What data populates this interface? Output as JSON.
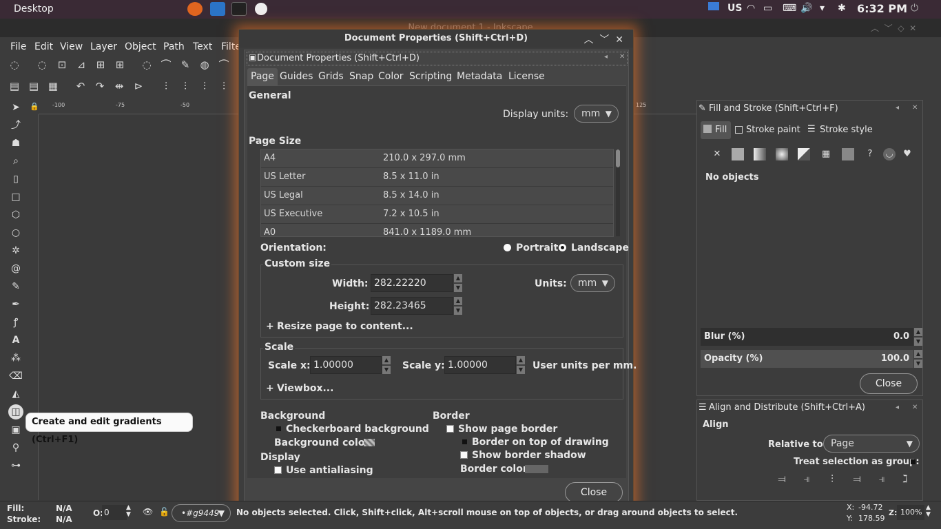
{
  "system_bar": {
    "desktop_label": "Desktop",
    "keyboard": "US",
    "time": "6:32 PM"
  },
  "window_title": "New document 1 - Inkscape",
  "menubar": [
    "File",
    "Edit",
    "View",
    "Layer",
    "Object",
    "Path",
    "Text",
    "Filte"
  ],
  "ruler": {
    "ticks": [
      "-100",
      "-75",
      "-50",
      "125"
    ]
  },
  "dialog": {
    "title": "Document Properties (Shift+Ctrl+D)",
    "inner_title": "Document Properties (Shift+Ctrl+D)",
    "tabs": [
      "Page",
      "Guides",
      "Grids",
      "Snap",
      "Color",
      "Scripting",
      "Metadata",
      "License"
    ],
    "active_tab": "Page",
    "general_label": "General",
    "display_units_label": "Display units:",
    "display_units_value": "mm",
    "page_size_label": "Page Size",
    "page_sizes": [
      {
        "name": "A4",
        "size": "210.0 x 297.0 mm"
      },
      {
        "name": "US Letter",
        "size": "8.5 x 11.0 in"
      },
      {
        "name": "US Legal",
        "size": "8.5 x 14.0 in"
      },
      {
        "name": "US Executive",
        "size": "7.2 x 10.5 in"
      },
      {
        "name": "A0",
        "size": "841.0 x 1189.0 mm"
      }
    ],
    "orientation_label": "Orientation:",
    "portrait_label": "Portrait",
    "landscape_label": "Landscape",
    "custom_size_label": "Custom size",
    "width_label": "Width:",
    "width_value": "282.22220",
    "height_label": "Height:",
    "height_value": "282.23465",
    "units_label": "Units:",
    "units_value": "mm",
    "resize_label": "Resize page to content...",
    "scale_label": "Scale",
    "scale_x_label": "Scale x:",
    "scale_x_value": "1.00000",
    "scale_y_label": "Scale y:",
    "scale_y_value": "1.00000",
    "user_units_label": "User units per mm.",
    "viewbox_label": "Viewbox...",
    "background_label": "Background",
    "checkerboard_label": "Checkerboard background",
    "bg_color_label": "Background color:",
    "display_label": "Display",
    "antialias_label": "Use antialiasing",
    "border_label": "Border",
    "show_border_label": "Show page border",
    "border_top_label": "Border on top of drawing",
    "border_shadow_label": "Show border shadow",
    "border_color_label": "Border color:",
    "close_label": "Close"
  },
  "fill_stroke": {
    "title": "Fill and Stroke (Shift+Ctrl+F)",
    "tab_fill": "Fill",
    "tab_stroke_paint": "Stroke paint",
    "tab_stroke_style": "Stroke style",
    "no_objects": "No objects",
    "blur_label": "Blur (%)",
    "blur_value": "0.0",
    "opacity_label": "Opacity (%)",
    "opacity_value": "100.0",
    "close_label": "Close"
  },
  "align": {
    "title": "Align and Distribute (Shift+Ctrl+A)",
    "align_label": "Align",
    "relative_label": "Relative to:",
    "relative_value": "Page",
    "group_label": "Treat selection as group:"
  },
  "tooltip": "Create and edit gradients (Ctrl+F1)",
  "statusbar": {
    "fill_label": "Fill:",
    "fill_value": "N/A",
    "stroke_label": "Stroke:",
    "stroke_value": "N/A",
    "opacity_label": "O:",
    "opacity_value": "0",
    "layer_value": "•#g9449",
    "message": "No objects selected. Click, Shift+click, Alt+scroll mouse on top of objects, or drag around objects to select.",
    "x_label": "X:",
    "x_value": "-94.72",
    "y_label": "Y:",
    "y_value": "178.59",
    "zoom_label": "Z:",
    "zoom_value": "100%"
  }
}
